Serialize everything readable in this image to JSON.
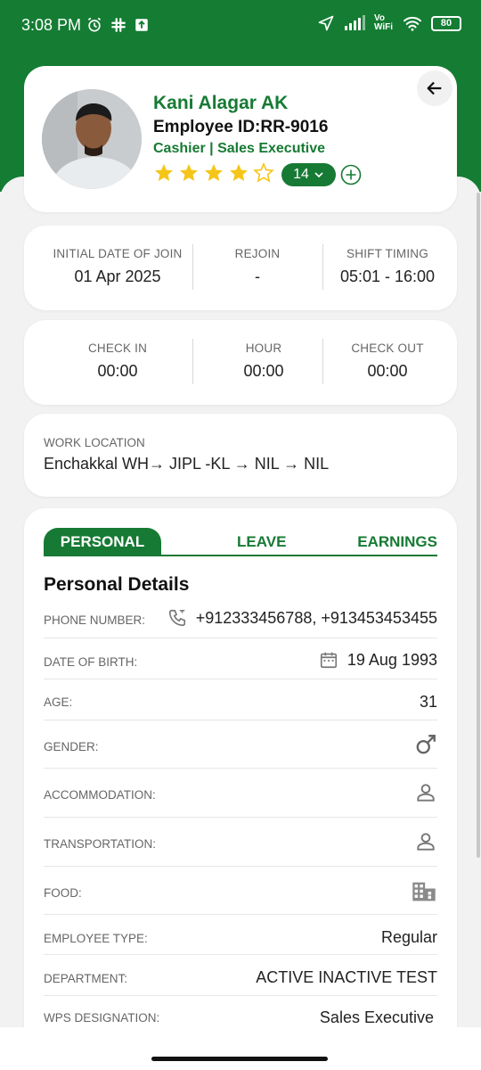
{
  "status_bar": {
    "time": "3:08 PM",
    "network_label": "Vo WiFi",
    "battery": "80"
  },
  "profile": {
    "name": "Kani Alagar AK",
    "employee_id": "Employee ID:RR-9016",
    "role": "Cashier | Sales Executive",
    "rating_stars": 4,
    "rating_max": 5,
    "rating_count": "14"
  },
  "join_info": [
    {
      "label": "INITIAL DATE OF JOIN",
      "value": "01 Apr 2025"
    },
    {
      "label": "REJOIN",
      "value": "-"
    },
    {
      "label": "SHIFT TIMING",
      "value": "05:01 - 16:00"
    }
  ],
  "attendance": [
    {
      "label": "CHECK IN",
      "value": "00:00"
    },
    {
      "label": "HOUR",
      "value": "00:00"
    },
    {
      "label": "CHECK OUT",
      "value": "00:00"
    }
  ],
  "work_location": {
    "label": "WORK LOCATION",
    "value": "Enchakkal WH→ JIPL -KL → NIL → NIL"
  },
  "tabs": [
    "PERSONAL",
    "LEAVE",
    "EARNINGS"
  ],
  "active_tab": "PERSONAL",
  "section_title": "Personal Details",
  "details": [
    {
      "label": "PHONE NUMBER:",
      "value": "+912333456788, +913453453455",
      "icon": "phone-icon"
    },
    {
      "label": "DATE OF BIRTH:",
      "value": "19 Aug 1993",
      "icon": "calendar-icon"
    },
    {
      "label": "AGE:",
      "value": "31"
    },
    {
      "label": "GENDER:",
      "icon": "male-icon"
    },
    {
      "label": "ACCOMMODATION:",
      "icon": "person-icon"
    },
    {
      "label": "TRANSPORTATION:",
      "icon": "person-icon"
    },
    {
      "label": "FOOD:",
      "icon": "building-icon"
    },
    {
      "label": "EMPLOYEE TYPE:",
      "value": "Regular"
    },
    {
      "label": "DEPARTMENT:",
      "value": "ACTIVE INACTIVE TEST"
    },
    {
      "label": "WPS DESIGNATION:",
      "value": "Sales Executive"
    }
  ],
  "colors": {
    "brand_green": "#177a34",
    "header_green": "#147d33",
    "star_yellow": "#f5c518"
  }
}
